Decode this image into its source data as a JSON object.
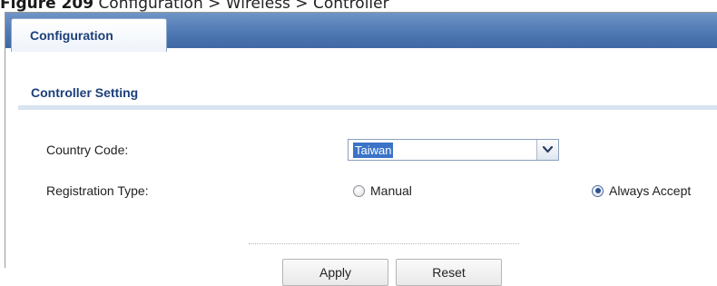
{
  "caption": {
    "figure_label": "Figure 209",
    "path": "Configuration > Wireless > Controller"
  },
  "tab": {
    "label": "Configuration"
  },
  "section": {
    "title": "Controller Setting"
  },
  "fields": {
    "country_code_label": "Country Code:",
    "country_code_value": "Taiwan",
    "registration_type_label": "Registration Type:",
    "registration_options": [
      {
        "label": "Manual",
        "selected": false
      },
      {
        "label": "Always Accept",
        "selected": true
      }
    ]
  },
  "buttons": {
    "apply_label": "Apply",
    "reset_label": "Reset"
  },
  "icons": {
    "dropdown": "chevron-down-icon"
  },
  "colors": {
    "header_blue": "#4f79b3",
    "title_blue": "#1c3f7a",
    "selection_blue": "#3a73c8"
  }
}
